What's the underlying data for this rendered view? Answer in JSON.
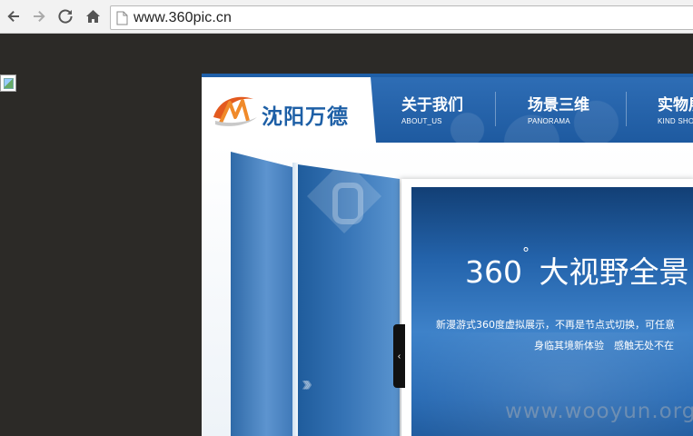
{
  "browser": {
    "url": "www.360pic.cn",
    "icons": [
      "back-arrow-icon",
      "forward-arrow-icon",
      "reload-icon",
      "home-icon",
      "page-icon"
    ]
  },
  "site": {
    "logo_text": "沈阳万德",
    "nav": [
      {
        "cn": "关于我们",
        "en": "ABOUT_US"
      },
      {
        "cn": "场景三维",
        "en": "PANORAMA"
      },
      {
        "cn": "实物展",
        "en": "KIND SHO"
      }
    ],
    "banner": {
      "headline_number": "360",
      "headline_degree": "°",
      "headline_text": "大视野全景",
      "desc_line1": "新漫游式360度虚拟展示，不再是节点式切换，可任意",
      "desc_line2": "身临其境新体验　感触无处不在"
    }
  },
  "watermark": "www.wooyun.org",
  "colors": {
    "brand_blue": "#1d5fa6",
    "nav_blue": "#2e6db5",
    "page_bg": "#2c2a27"
  }
}
